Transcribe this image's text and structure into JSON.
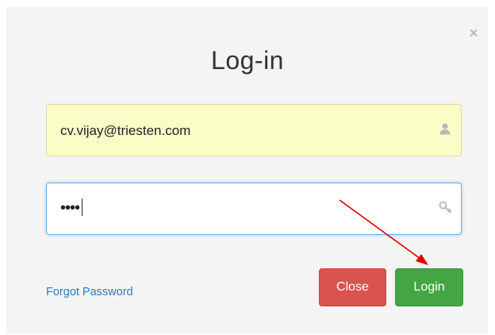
{
  "modal": {
    "title": "Log-in",
    "close_icon": "×"
  },
  "form": {
    "email_value": "cv.vijay@triesten.com",
    "email_icon": "user-icon",
    "password_masked": "••••",
    "password_icon": "key-icon"
  },
  "links": {
    "forgot_password": "Forgot Password"
  },
  "buttons": {
    "close_label": "Close",
    "login_label": "Login"
  },
  "colors": {
    "close_button": "#d9534f",
    "login_button": "#45a545",
    "email_field_bg": "#fafdc6",
    "focus_border": "#66afe9",
    "annotation_arrow": "#e00000"
  },
  "annotation": {
    "type": "arrow",
    "points_to": "login-button"
  }
}
